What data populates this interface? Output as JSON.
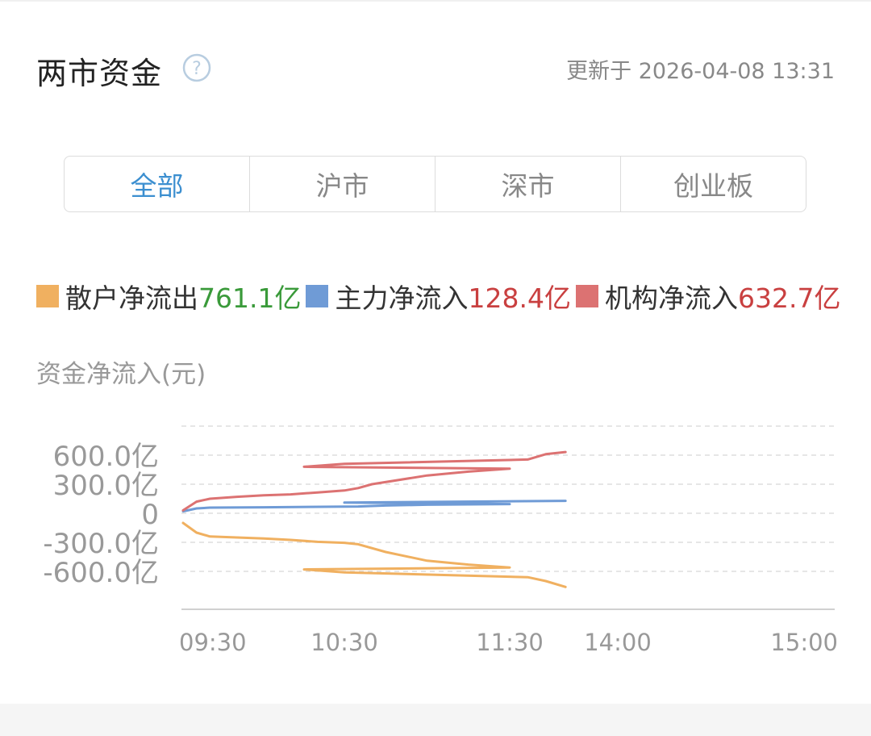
{
  "header": {
    "title": "两市资金",
    "updated": "更新于 2026-04-08 13:31"
  },
  "tabs": [
    {
      "label": "全部",
      "active": true
    },
    {
      "label": "沪市",
      "active": false
    },
    {
      "label": "深市",
      "active": false
    },
    {
      "label": "创业板",
      "active": false
    }
  ],
  "legend": [
    {
      "name": "散户净流出",
      "value": "761.1亿",
      "swatch": "#f0b060",
      "value_color": "green"
    },
    {
      "name": "主力净流入",
      "value": "128.4亿",
      "swatch": "#6f9bd6",
      "value_color": "red"
    },
    {
      "name": "机构净流入",
      "value": "632.7亿",
      "swatch": "#dc7272",
      "value_color": "red"
    }
  ],
  "chart_data": {
    "type": "line",
    "ylabel": "资金净流入(元)",
    "yticks": [
      "600.0亿",
      "300.0亿",
      "0",
      "-300.0亿",
      "-600.0亿"
    ],
    "ytick_values": [
      600,
      300,
      0,
      -300,
      -600
    ],
    "ylim": [
      -900,
      900
    ],
    "xticks": [
      "09:30",
      "10:30",
      "11:30",
      "14:00",
      "15:00"
    ],
    "grid": true,
    "series": [
      {
        "name": "散户净流出",
        "color": "#f0b060",
        "x": [
          "09:30",
          "09:35",
          "09:40",
          "09:50",
          "10:00",
          "10:10",
          "10:20",
          "10:30",
          "10:35",
          "10:45",
          "11:00",
          "11:15",
          "11:30",
          "11:45",
          "12:00",
          "13:10",
          "13:20",
          "13:31"
        ],
        "values": [
          -100,
          -200,
          -240,
          -250,
          -260,
          -275,
          -295,
          -305,
          -320,
          -400,
          -490,
          -530,
          -560,
          -580,
          -610,
          -660,
          -700,
          -761.1
        ]
      },
      {
        "name": "主力净流入",
        "color": "#6f9bd6",
        "x": [
          "09:30",
          "09:35",
          "09:40",
          "10:00",
          "10:30",
          "10:35",
          "10:45",
          "11:00",
          "11:30",
          "12:00",
          "13:31"
        ],
        "values": [
          20,
          50,
          58,
          62,
          68,
          70,
          80,
          88,
          95,
          110,
          128.4
        ]
      },
      {
        "name": "机构净流入",
        "color": "#dc7272",
        "x": [
          "09:30",
          "09:35",
          "09:40",
          "09:50",
          "10:00",
          "10:10",
          "10:20",
          "10:30",
          "10:35",
          "10:40",
          "11:00",
          "11:15",
          "11:30",
          "11:45",
          "12:00",
          "13:10",
          "13:20",
          "13:31"
        ],
        "values": [
          30,
          120,
          150,
          170,
          185,
          195,
          215,
          235,
          260,
          300,
          390,
          430,
          460,
          480,
          510,
          555,
          610,
          632.7
        ]
      }
    ]
  }
}
